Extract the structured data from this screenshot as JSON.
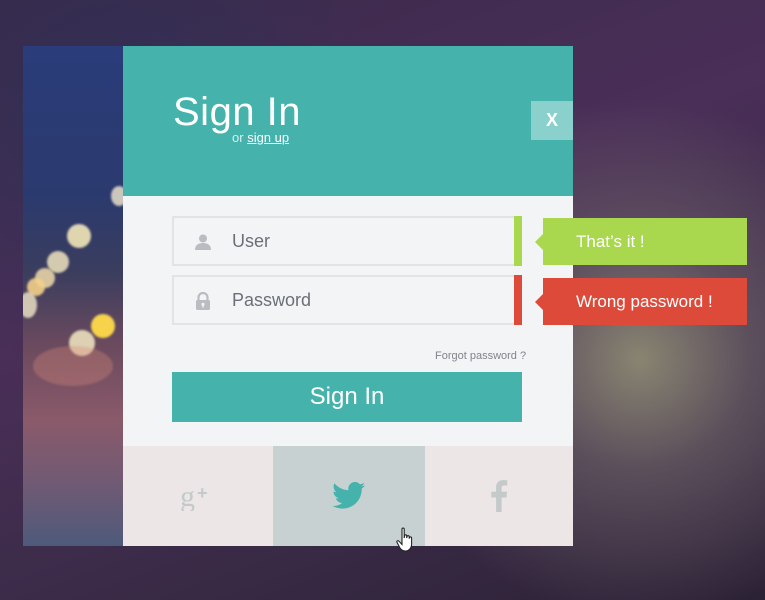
{
  "colors": {
    "accent": "#45b2ac",
    "valid": "#a9d84e",
    "error": "#de4a3a",
    "social_bg": "#ede6e6",
    "social_active_bg": "#c8d1d2"
  },
  "header": {
    "title": "Sign In",
    "subtitle_prefix": "or",
    "signup_link": "sign up",
    "close_label": "X"
  },
  "form": {
    "user_placeholder": "User",
    "user_icon": "user-icon",
    "password_placeholder": "Password",
    "password_icon": "lock-icon",
    "forgot_label": "Forgot password ?",
    "submit_label": "Sign In"
  },
  "tooltips": {
    "user_valid": "That’s it !",
    "password_error": "Wrong password !"
  },
  "social": [
    {
      "name": "google-plus",
      "icon": "google-plus-icon"
    },
    {
      "name": "twitter",
      "icon": "twitter-icon",
      "active": true
    },
    {
      "name": "facebook",
      "icon": "facebook-icon"
    }
  ]
}
